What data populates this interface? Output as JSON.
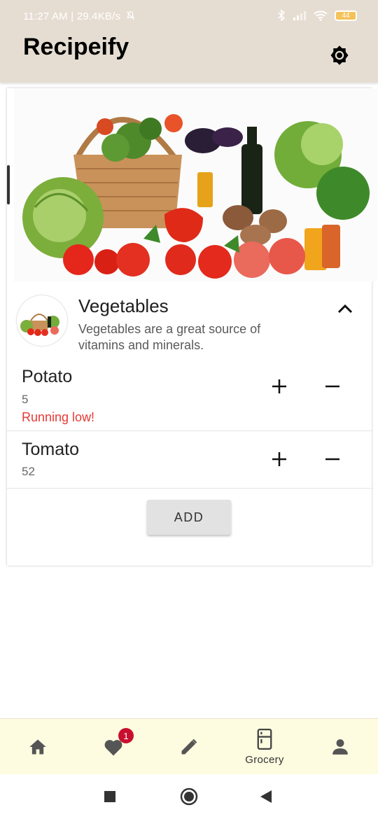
{
  "status_bar": {
    "time_speed": "11:27 AM | 29.4KB/s",
    "battery": "44",
    "icons": [
      "mute-bell-icon",
      "bluetooth-icon",
      "signal-icon",
      "wifi-icon",
      "battery-icon"
    ]
  },
  "app_bar": {
    "title": "Recipeify",
    "action_icon": "brightness-icon"
  },
  "category": {
    "title": "Vegetables",
    "description": "Vegetables are a great source of vitamins and minerals.",
    "collapse_icon": "chevron-up-icon"
  },
  "items": [
    {
      "name": "Potato",
      "quantity": "5",
      "warning": "Running low!"
    },
    {
      "name": "Tomato",
      "quantity": "52",
      "warning": ""
    }
  ],
  "add_button": {
    "label": "ADD"
  },
  "bottom_nav": {
    "items": [
      {
        "icon": "home-icon",
        "label": ""
      },
      {
        "icon": "heart-icon",
        "label": "",
        "badge": "1"
      },
      {
        "icon": "pencil-icon",
        "label": ""
      },
      {
        "icon": "fridge-icon",
        "label": "Grocery"
      },
      {
        "icon": "person-icon",
        "label": ""
      }
    ],
    "active_index": 3
  },
  "system_nav": [
    "square-recents-icon",
    "circle-home-icon",
    "triangle-back-icon"
  ],
  "colors": {
    "app_bar": "#e6ddd2",
    "bottom_nav": "#fdfbe0",
    "warning": "#e53935",
    "badge": "#c8102e"
  }
}
